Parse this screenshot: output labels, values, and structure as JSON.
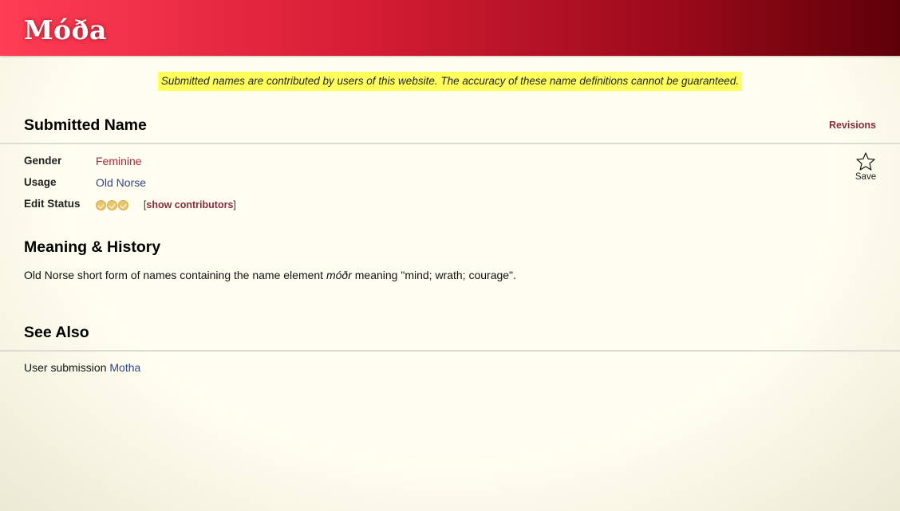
{
  "header": {
    "site_title": "Móða"
  },
  "notice": {
    "text": "Submitted names are contributed by users of this website. The accuracy of these name definitions cannot be guaranteed."
  },
  "name_section": {
    "title": "Submitted Name",
    "revisions_label": "Revisions",
    "rows": {
      "gender": {
        "label": "Gender",
        "value": "Feminine"
      },
      "usage": {
        "label": "Usage",
        "value": "Old Norse"
      },
      "edit_status": {
        "label": "Edit Status",
        "checks": 3,
        "contributors_open": "[",
        "contributors_label": "show contributors",
        "contributors_close": "]"
      }
    },
    "save_label": "Save"
  },
  "meaning": {
    "title": "Meaning & History",
    "text_before": "Old Norse short form of names containing the name element ",
    "element": "móðr",
    "text_after": " meaning \"mind; wrath; courage\"."
  },
  "see_also": {
    "title": "See Also",
    "prefix": "User submission ",
    "link": "Motha"
  },
  "colors": {
    "header_start": "#ff3d55",
    "header_end": "#5e0008",
    "notice_bg": "#ffff5c",
    "page_bg": "#fffef0",
    "link_red": "#a8283a",
    "link_blue": "#2f4488",
    "check_gold": "#e8c56e"
  },
  "icons": {
    "save": "star-outline-icon",
    "status_check": "check-circle-icon"
  }
}
